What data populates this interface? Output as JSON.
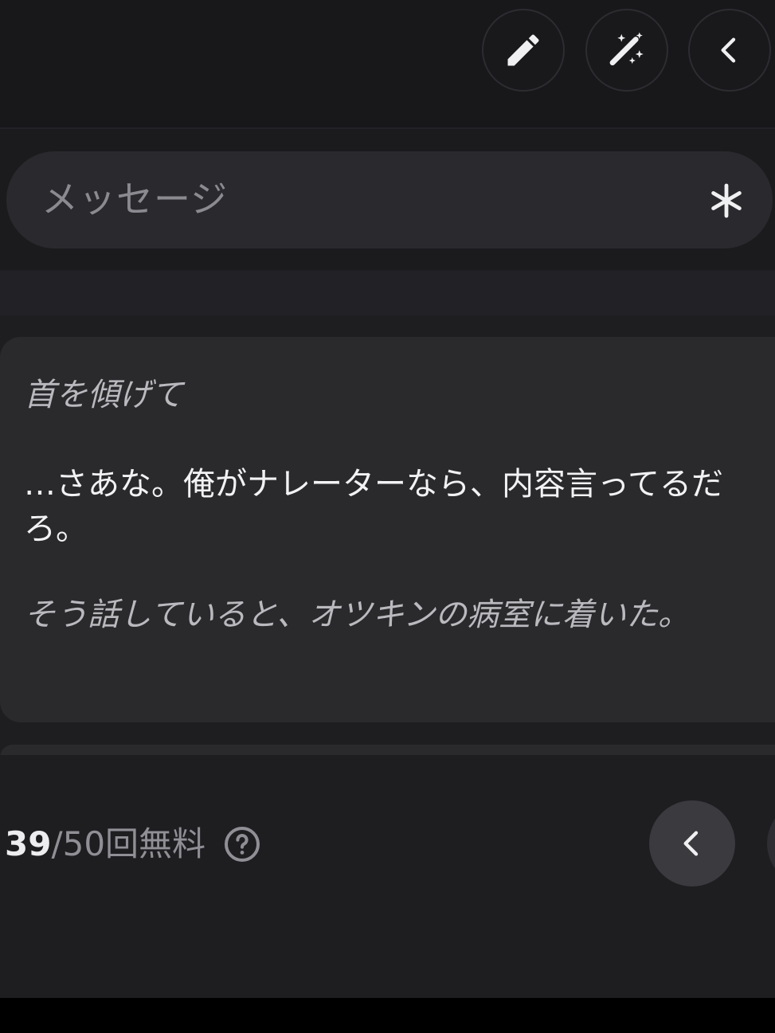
{
  "toolbar": {
    "edit_icon": "pencil-icon",
    "magic_icon": "magic-wand-icon",
    "back_icon": "chevron-left-icon"
  },
  "composer": {
    "placeholder": "メッセージ",
    "asterisk_icon": "asterisk-icon"
  },
  "message": {
    "action_1": "首を傾げて",
    "speech": "…さあな。俺がナレーターなら、内容言ってるだろ。",
    "action_2": "そう話していると、オツキンの病室に着いた。"
  },
  "usage": {
    "current": "39",
    "rest": "/50回無料",
    "help_icon": "question-circle-icon"
  },
  "navigation": {
    "prev_icon": "chevron-left-icon"
  },
  "colors": {
    "background": "#1e1e21",
    "card": "#2a2a2d",
    "text_primary": "#f2f2f4",
    "text_secondary": "#b9b9be"
  }
}
